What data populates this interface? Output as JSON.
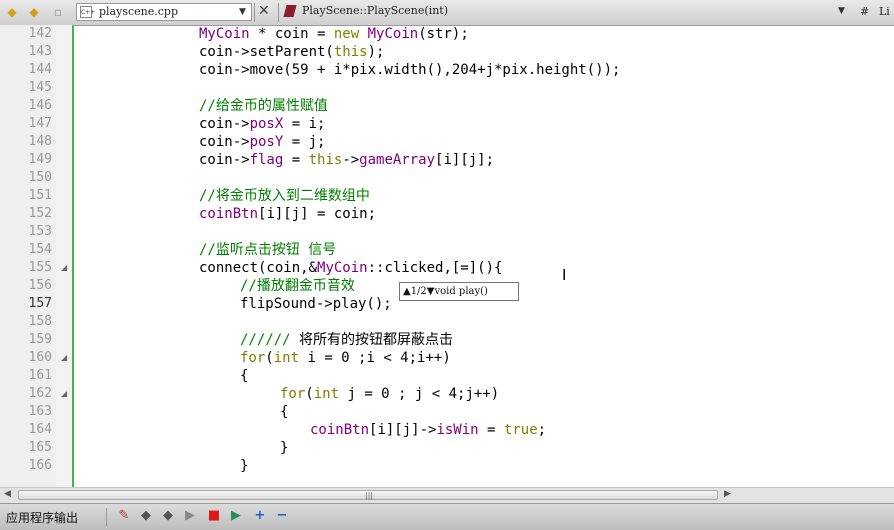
{
  "toolbar": {
    "back_icon": "arrow-left-icon",
    "forward_icon": "arrow-right-icon",
    "file_name": "playscene.cpp",
    "file_icon_text": "C++",
    "symbol": "PlayScene::PlayScene(int)",
    "hash_label": "#",
    "lin_label": "Li"
  },
  "editor": {
    "current_line": "157",
    "lines": [
      {
        "n": "142"
      },
      {
        "n": "143"
      },
      {
        "n": "144"
      },
      {
        "n": "145"
      },
      {
        "n": "146"
      },
      {
        "n": "147"
      },
      {
        "n": "148"
      },
      {
        "n": "149"
      },
      {
        "n": "150"
      },
      {
        "n": "151"
      },
      {
        "n": "152"
      },
      {
        "n": "153"
      },
      {
        "n": "154"
      },
      {
        "n": "155"
      },
      {
        "n": "156"
      },
      {
        "n": "157"
      },
      {
        "n": "158"
      },
      {
        "n": "159"
      },
      {
        "n": "160"
      },
      {
        "n": "161"
      },
      {
        "n": "162"
      },
      {
        "n": "163"
      },
      {
        "n": "164"
      },
      {
        "n": "165"
      },
      {
        "n": "166"
      }
    ],
    "code": {
      "l142": {
        "a": "MyCoin",
        "b": " * coin = ",
        "c": "new",
        "d": " ",
        "e": "MyCoin",
        "f": "(str);"
      },
      "l143": {
        "a": "coin->setParent(",
        "b": "this",
        "c": ");"
      },
      "l144": {
        "a": "coin->move(59 + i*pix.width(),204+j*pix.height());"
      },
      "l146": {
        "a": "//给金币的属性赋值"
      },
      "l147": {
        "a": "coin->",
        "b": "posX",
        "c": " = i;"
      },
      "l148": {
        "a": "coin->",
        "b": "posY",
        "c": " = j;"
      },
      "l149": {
        "a": "coin->",
        "b": "flag",
        "c": " = ",
        "d": "this",
        "e": "->",
        "f": "gameArray",
        "g": "[i][j];"
      },
      "l151": {
        "a": "//将金币放入到二维数组中"
      },
      "l152": {
        "a": "coinBtn",
        "b": "[i][j] = coin;"
      },
      "l154": {
        "a": "//监听点击按钮 信号"
      },
      "l155": {
        "a": "connect(coin,&",
        "b": "MyCoin",
        "c": "::clicked,[=](){"
      },
      "l156": {
        "a": "//播放翻金币音效"
      },
      "l157": {
        "a": "flipSound->play();"
      },
      "l159": {
        "a": "////// ",
        "b": "将所有的按钮都屏蔽点击"
      },
      "l160": {
        "a": "for",
        "b": "(",
        "c": "int",
        "d": " i = 0 ;i < 4;i++)"
      },
      "l161": {
        "a": "{"
      },
      "l162": {
        "a": "for",
        "b": "(",
        "c": "int",
        "d": " j = 0 ; j < 4;j++)"
      },
      "l163": {
        "a": "{"
      },
      "l164": {
        "a": "coinBtn",
        "b": "[i][j]->",
        "c": "isWin",
        "d": " = ",
        "e": "true",
        "f": ";"
      },
      "l165": {
        "a": "}"
      },
      "l166": {
        "a": "}"
      }
    },
    "tooltip": "▲1/2▼void play()"
  },
  "output_panel": {
    "title": "应用程序输出"
  },
  "colors": {
    "keyword": "#808000",
    "type": "#800080",
    "member": "#00677c",
    "comment": "#008000",
    "change_bar": "#4caf50"
  }
}
